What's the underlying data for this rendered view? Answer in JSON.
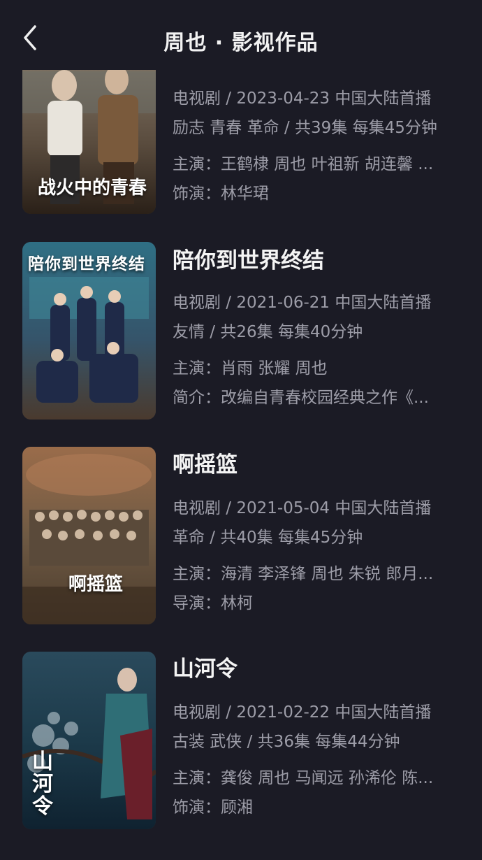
{
  "header": {
    "title": "周也 · 影视作品"
  },
  "colors": {
    "background": "#1b1b25",
    "title_text": "#f4f4f4",
    "meta_text": "#9d9da8"
  },
  "works": [
    {
      "title": "",
      "meta_line": "电视剧 / 2023-04-23 中国大陆首播",
      "genre_line": "励志 青春 革命 / 共39集 每集45分钟",
      "line3": "主演：王鹤棣 周也 叶祖新 胡连馨 ...",
      "line4": "饰演：林华珺",
      "poster_text": "战火中的青春"
    },
    {
      "title": "陪你到世界终结",
      "meta_line": "电视剧 / 2021-06-21 中国大陆首播",
      "genre_line": "友情 / 共26集 每集40分钟",
      "line3": "主演：肖雨 张耀 周也",
      "line4": "简介：改编自青春校园经典之作《...",
      "poster_text": "陪你到世界终结"
    },
    {
      "title": "啊摇篮",
      "meta_line": "电视剧 / 2021-05-04 中国大陆首播",
      "genre_line": "革命 / 共40集 每集45分钟",
      "line3": "主演：海清 李泽锋 周也 朱锐 郎月...",
      "line4": "导演：林柯",
      "poster_text": "啊摇篮"
    },
    {
      "title": "山河令",
      "meta_line": "电视剧 / 2021-02-22 中国大陆首播",
      "genre_line": "古装 武侠 / 共36集 每集44分钟",
      "line3": "主演：龚俊 周也 马闻远 孙浠伦 陈...",
      "line4": "饰演：顾湘",
      "poster_text": "山河令"
    }
  ]
}
